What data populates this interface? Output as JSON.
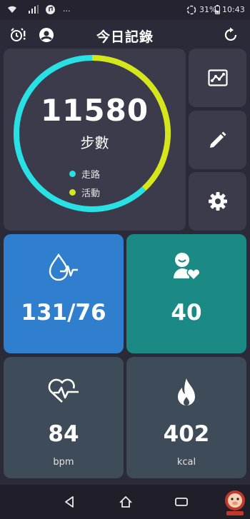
{
  "status_bar": {
    "dots": "...",
    "battery_percent": "31%",
    "time": "10:43"
  },
  "header": {
    "title": "今日記錄"
  },
  "steps": {
    "value": "11580",
    "label": "步數",
    "legend": [
      {
        "label": "走路",
        "color": "#27e1e4"
      },
      {
        "label": "活動",
        "color": "#d5e61b"
      }
    ],
    "ring_fractions": {
      "walk": 0.62,
      "activity": 0.38
    }
  },
  "tiles": {
    "blood_pressure": {
      "value": "131/76",
      "color": "#2f7fce"
    },
    "mood": {
      "value": "40",
      "color": "#1b8a85"
    },
    "heart_rate": {
      "value": "84",
      "unit": "bpm",
      "color": "#3e4b59"
    },
    "calories": {
      "value": "402",
      "unit": "kcal",
      "color": "#3e4b59"
    }
  },
  "icons": {
    "alarm": "alarm-alert-icon",
    "profile": "profile-icon",
    "refresh": "refresh-icon",
    "chart": "trend-chart-icon",
    "edit": "pencil-icon",
    "settings": "gear-icon"
  }
}
